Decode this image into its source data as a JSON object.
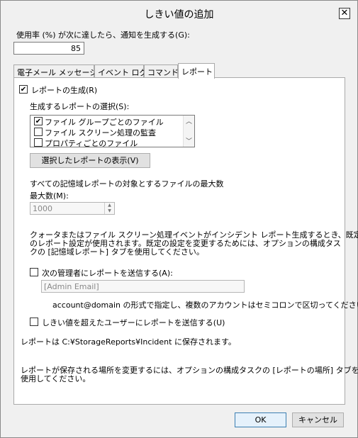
{
  "window": {
    "title": "しきい値の追加"
  },
  "usage": {
    "label": "使用率 (%) が次に達したら、通知を生成する(G):",
    "value": "85"
  },
  "tabs": [
    {
      "label": "電子メール メッセージ"
    },
    {
      "label": "イベント ログ"
    },
    {
      "label": "コマンド"
    },
    {
      "label": "レポート"
    }
  ],
  "report": {
    "generate_label": "レポートの生成(R)",
    "select_label": "生成するレポートの選択(S):",
    "list_items": [
      {
        "label": "ファイル グループごとのファイル",
        "checked": true
      },
      {
        "label": "ファイル スクリーン処理の監査",
        "checked": false
      },
      {
        "label": "プロパティごとのファイル",
        "checked": false
      }
    ],
    "show_selected_button": "選択したレポートの表示(V)",
    "max_files_heading": "すべての記憶域レポートの対象とするファイルの最大数",
    "max_count_label": "最大数(M):",
    "max_count_value": "1000",
    "info_line1": "クォータまたはファイル スクリーン処理イベントがインシデント レポート生成するとき、既定",
    "info_line2": "のレポート設定が使用されます。既定の設定を変更するためには、オプションの構成タス",
    "info_line3": "クの [記憶域レポート] タブを使用してください。",
    "send_admin_label": "次の管理者にレポートを送信する(A):",
    "admin_email_value": "[Admin Email]",
    "account_hint": "account@domain の形式で指定し、複数のアカウントはセミコロンで区切ってください。",
    "send_user_label": "しきい値を超えたユーザーにレポートを送信する(U)",
    "saved_path": "レポートは C:¥StorageReports¥Incident に保存されます。",
    "change_line1": "レポートが保存される場所を変更するには、オプションの構成タスクの [レポートの場所] タブを",
    "change_line2": "使用してください。"
  },
  "buttons": {
    "ok": "OK",
    "cancel": "キャンセル"
  }
}
